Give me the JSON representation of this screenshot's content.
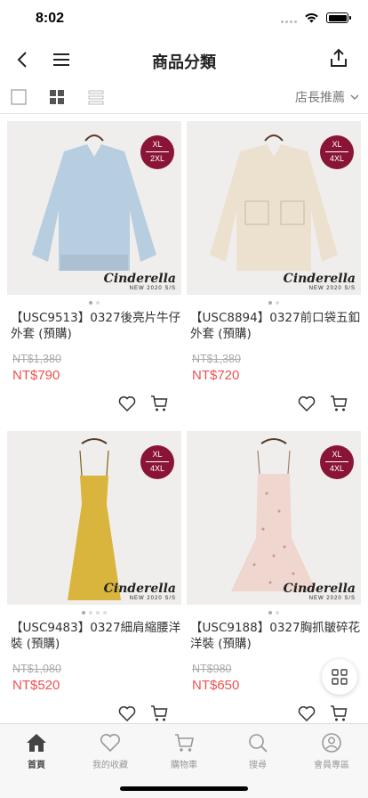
{
  "status": {
    "time": "8:02"
  },
  "header": {
    "title": "商品分類"
  },
  "toolbar": {
    "sort_label": "店長推薦"
  },
  "brand": {
    "logo": "Cinderella",
    "season": "NEW 2020 S/S"
  },
  "products": [
    {
      "name": "【USC9513】0327後亮片牛仔外套 (預購)",
      "old_price": "NT$1,380",
      "price": "NT$790",
      "badge_top": "XL",
      "badge_bottom": "2XL",
      "color": "#b7cde0"
    },
    {
      "name": "【USC8894】0327前口袋五釦外套 (預購)",
      "old_price": "NT$1,380",
      "price": "NT$720",
      "badge_top": "XL",
      "badge_bottom": "4XL",
      "color": "#ece1cf"
    },
    {
      "name": "【USC9483】0327細肩縮腰洋裝 (預購)",
      "old_price": "NT$1,080",
      "price": "NT$520",
      "badge_top": "XL",
      "badge_bottom": "4XL",
      "color": "#d9b53d"
    },
    {
      "name": "【USC9188】0327胸抓皺碎花洋裝 (預購)",
      "old_price": "NT$980",
      "price": "NT$650",
      "badge_top": "XL",
      "badge_bottom": "4XL",
      "color": "#efd6cf"
    }
  ],
  "tabs": [
    {
      "label": "首頁",
      "icon": "home-icon"
    },
    {
      "label": "我的收藏",
      "icon": "heart-icon"
    },
    {
      "label": "購物車",
      "icon": "cart-icon"
    },
    {
      "label": "搜尋",
      "icon": "search-icon"
    },
    {
      "label": "會員專區",
      "icon": "user-icon"
    }
  ],
  "colors": {
    "accent": "#f05050",
    "badge": "#8a1436"
  }
}
